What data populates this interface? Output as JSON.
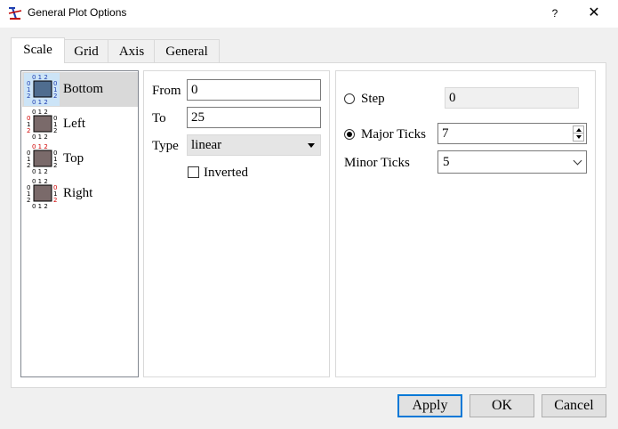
{
  "window": {
    "title": "General Plot Options",
    "help_label": "?",
    "close_label": "✕",
    "icon": "plot-axis-icon"
  },
  "tabs": [
    {
      "label": "Scale",
      "active": true
    },
    {
      "label": "Grid",
      "active": false
    },
    {
      "label": "Axis",
      "active": false
    },
    {
      "label": "General",
      "active": false
    }
  ],
  "axes": [
    {
      "label": "Bottom",
      "selected": true
    },
    {
      "label": "Left",
      "selected": false
    },
    {
      "label": "Top",
      "selected": false
    },
    {
      "label": "Right",
      "selected": false
    }
  ],
  "axis_icon_ticks": "0 1 2",
  "range": {
    "from_label": "From",
    "from_value": "0",
    "to_label": "To",
    "to_value": "25",
    "type_label": "Type",
    "type_value": "linear",
    "inverted_label": "Inverted",
    "inverted_checked": false
  },
  "ticks": {
    "step_label": "Step",
    "step_value": "0",
    "step_selected": false,
    "major_label": "Major Ticks",
    "major_value": "7",
    "major_selected": true,
    "minor_label": "Minor Ticks",
    "minor_value": "5"
  },
  "buttons": {
    "apply": "Apply",
    "ok": "OK",
    "cancel": "Cancel"
  },
  "colors": {
    "selection_accent": "#0078d7",
    "icon_box_selected": "#4f6d8f",
    "icon_box": "#7a6a6a",
    "tick_red": "#d00000",
    "tick_blue": "#1f3fb0"
  }
}
